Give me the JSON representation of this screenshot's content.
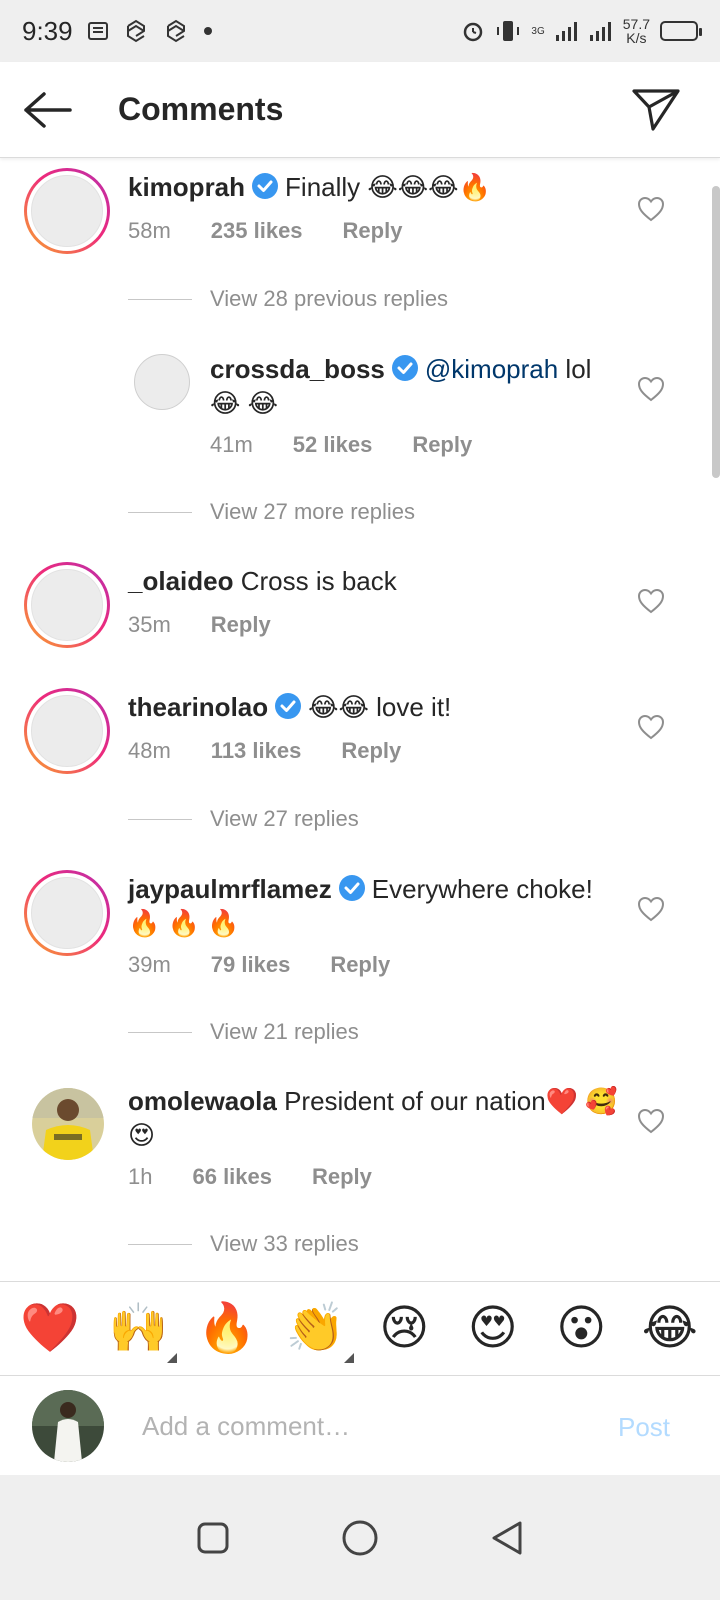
{
  "status_bar": {
    "time": "9:39",
    "net_speed_value": "57.7",
    "net_speed_unit": "K/s",
    "signal_label": "3G"
  },
  "header": {
    "title": "Comments"
  },
  "comments": [
    {
      "username": "kimoprah",
      "verified": true,
      "text": "Finally 😂😂😂🔥",
      "time": "58m",
      "likes": "235 likes",
      "reply_label": "Reply",
      "view_replies": "View 28 previous replies"
    },
    {
      "username": "crossda_boss",
      "verified": true,
      "is_reply": true,
      "mention": "@kimoprah",
      "text": " lol 😂 😂",
      "time": "41m",
      "likes": "52 likes",
      "reply_label": "Reply",
      "view_replies": "View 27 more replies"
    },
    {
      "username": "_olaideo",
      "verified": false,
      "text": "Cross is back",
      "time": "35m",
      "reply_label": "Reply"
    },
    {
      "username": "thearinolao",
      "verified": true,
      "text": "😂😂 love it!",
      "time": "48m",
      "likes": "113 likes",
      "reply_label": "Reply",
      "view_replies": "View 27 replies"
    },
    {
      "username": "jaypaulmrflamez",
      "verified": true,
      "text": "Everywhere choke! 🔥 🔥 🔥",
      "time": "39m",
      "likes": "79 likes",
      "reply_label": "Reply",
      "view_replies": "View 21 replies"
    },
    {
      "username": "omolewaola",
      "verified": false,
      "text": "President of our nation❤️ 🥰😍",
      "time": "1h",
      "likes": "66 likes",
      "reply_label": "Reply",
      "view_replies": "View 33 replies"
    }
  ],
  "reactions": [
    "❤️",
    "🙌",
    "🔥",
    "👏",
    "😢",
    "😍",
    "😮",
    "😂"
  ],
  "composer": {
    "placeholder": "Add a comment…",
    "post_label": "Post"
  },
  "colors": {
    "verified_blue": "#3897f0",
    "mention_blue": "#00376b",
    "meta_gray": "#8e8e8e",
    "post_disabled": "#b3dbff"
  },
  "icons": {
    "back": "arrow-left-icon",
    "direct": "paper-plane-icon",
    "like": "heart-outline-icon",
    "nav_recents": "square-icon",
    "nav_home": "circle-icon",
    "nav_back": "triangle-back-icon"
  }
}
